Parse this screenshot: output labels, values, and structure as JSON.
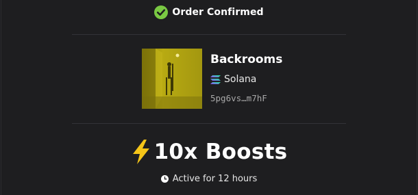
{
  "header": {
    "title": "Order Confirmed",
    "icon": "check-circle-icon",
    "icon_color": "#7ac943"
  },
  "token": {
    "name": "Backrooms",
    "chain": "Solana",
    "chain_icon": "solana-icon",
    "address": "5pg6vs…m7hF",
    "thumbnail": "backrooms-token-image"
  },
  "boost": {
    "label": "10x Boosts",
    "icon": "lightning-bolt-icon",
    "icon_color": "#f5c518"
  },
  "status": {
    "text": "Active for 12 hours",
    "icon": "clock-icon"
  },
  "colors": {
    "background": "#1e1e20",
    "divider": "#333337",
    "muted_text": "#a8a8a8"
  }
}
